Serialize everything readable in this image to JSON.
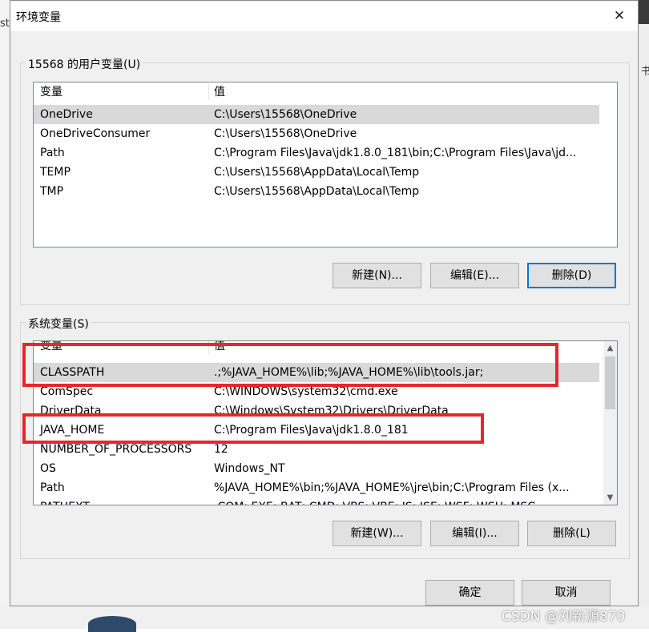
{
  "window": {
    "title": "环境变量",
    "close_glyph": "✕"
  },
  "user_vars": {
    "group_title": "15568 的用户变量(U)",
    "col_name": "变量",
    "col_value": "值",
    "rows": [
      {
        "name": "OneDrive",
        "value": "C:\\Users\\15568\\OneDrive"
      },
      {
        "name": "OneDriveConsumer",
        "value": "C:\\Users\\15568\\OneDrive"
      },
      {
        "name": "Path",
        "value": "C:\\Program Files\\Java\\jdk1.8.0_181\\bin;C:\\Program Files\\Java\\jd..."
      },
      {
        "name": "TEMP",
        "value": "C:\\Users\\15568\\AppData\\Local\\Temp"
      },
      {
        "name": "TMP",
        "value": "C:\\Users\\15568\\AppData\\Local\\Temp"
      }
    ],
    "buttons": {
      "new": "新建(N)...",
      "edit": "编辑(E)...",
      "delete": "删除(D)"
    }
  },
  "system_vars": {
    "group_title": "系统变量(S)",
    "col_name": "变量",
    "col_value": "值",
    "rows": [
      {
        "name": "CLASSPATH",
        "value": ".;%JAVA_HOME%\\lib;%JAVA_HOME%\\lib\\tools.jar;"
      },
      {
        "name": "ComSpec",
        "value": "C:\\WINDOWS\\system32\\cmd.exe"
      },
      {
        "name": "DriverData",
        "value": "C:\\Windows\\System32\\Drivers\\DriverData"
      },
      {
        "name": "JAVA_HOME",
        "value": "C:\\Program Files\\Java\\jdk1.8.0_181"
      },
      {
        "name": "NUMBER_OF_PROCESSORS",
        "value": "12"
      },
      {
        "name": "OS",
        "value": "Windows_NT"
      },
      {
        "name": "Path",
        "value": "%JAVA_HOME%\\bin;%JAVA_HOME%\\jre\\bin;C:\\Program Files (x..."
      },
      {
        "name": "PATHEXT",
        "value": ".COM;.EXE;.BAT;.CMD;.VBS;.VBE;.JS;.JSE;.WSF;.WSH;.MSC"
      }
    ],
    "buttons": {
      "new": "新建(W)...",
      "edit": "编辑(I)...",
      "delete": "删除(L)"
    }
  },
  "footer": {
    "ok": "确定",
    "cancel": "取消"
  },
  "background": {
    "right_fragment": "书",
    "left_fragment": "st"
  },
  "watermark": "CSDN @刘新源870",
  "colors": {
    "highlight": "#e8262c",
    "focus": "#0078d7",
    "selected_row": "#d9d9d9"
  }
}
